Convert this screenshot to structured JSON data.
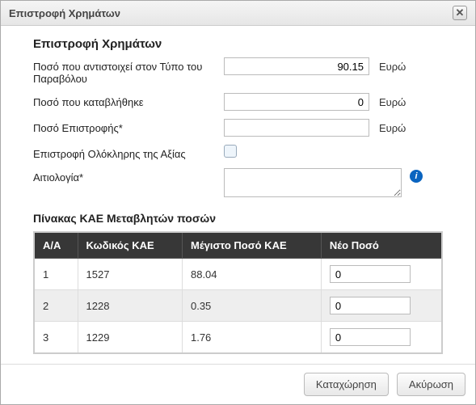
{
  "dialog": {
    "title": "Επιστροφή Χρημάτων"
  },
  "header": {
    "section_title": "Επιστροφή Χρημάτων"
  },
  "form": {
    "amount_type_label": "Ποσό που αντιστοιχεί στον Τύπο του Παραβόλου",
    "amount_type_value": "90.15",
    "amount_type_unit": "Ευρώ",
    "amount_paid_label": "Ποσό που καταβλήθηκε",
    "amount_paid_value": "0",
    "amount_paid_unit": "Ευρώ",
    "refund_amount_label": "Ποσό Επιστροφής*",
    "refund_amount_value": "",
    "refund_amount_unit": "Ευρώ",
    "full_refund_label": "Επιστροφή Ολόκληρης της Αξίας",
    "justification_label": "Αιτιολογία*",
    "justification_value": ""
  },
  "table": {
    "heading": "Πίνακας ΚΑΕ Μεταβλητών ποσών",
    "headers": {
      "aa": "Α/Α",
      "code": "Κωδικός ΚΑΕ",
      "max": "Μέγιστο Ποσό ΚΑΕ",
      "new": "Νέο Ποσό"
    },
    "rows": [
      {
        "aa": "1",
        "code": "1527",
        "max": "88.04",
        "new": "0"
      },
      {
        "aa": "2",
        "code": "1228",
        "max": "0.35",
        "new": "0"
      },
      {
        "aa": "3",
        "code": "1229",
        "max": "1.76",
        "new": "0"
      }
    ]
  },
  "buttons": {
    "submit": "Καταχώρηση",
    "cancel": "Ακύρωση"
  }
}
